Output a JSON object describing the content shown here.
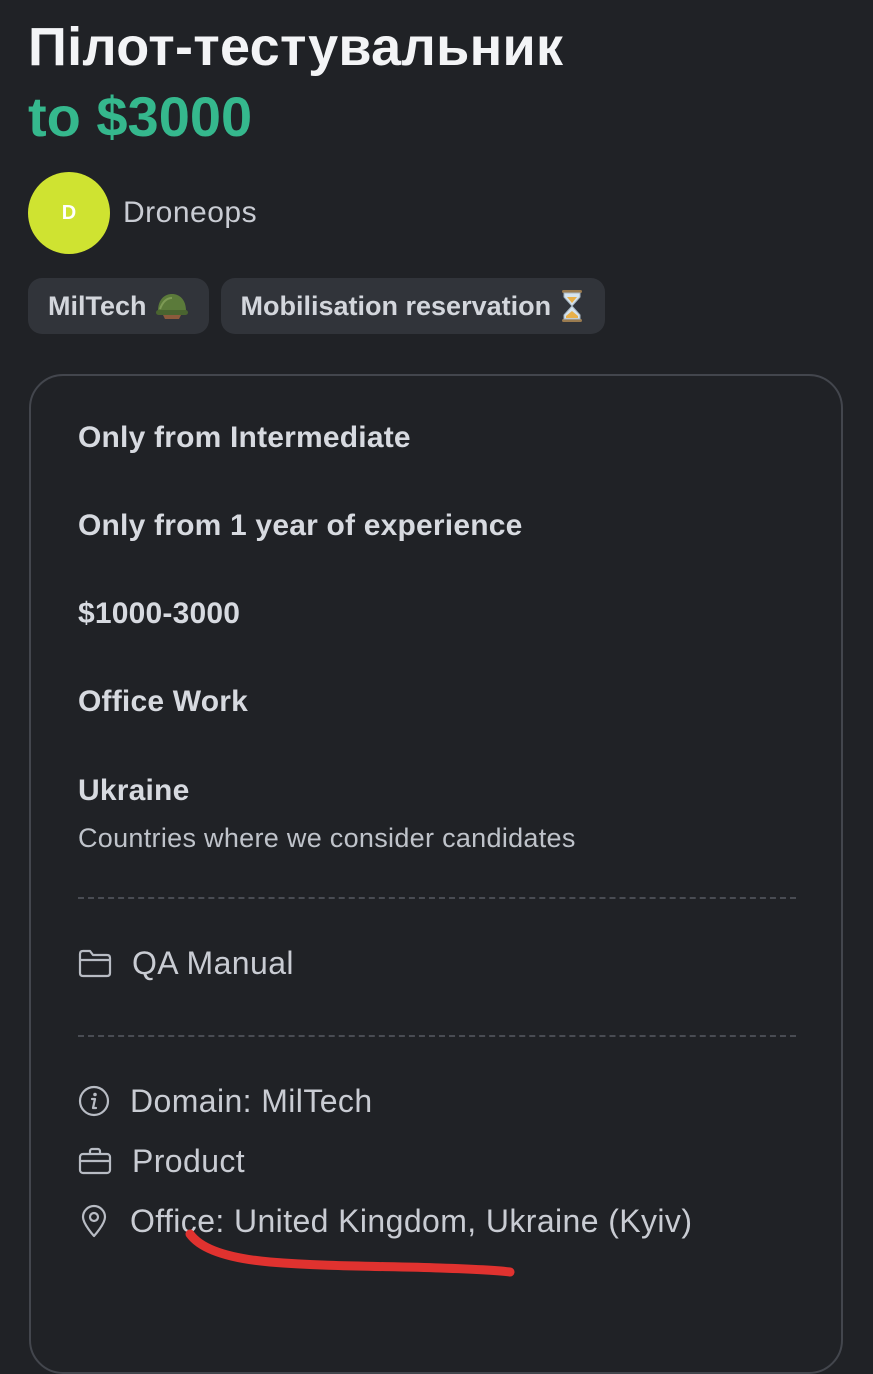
{
  "job": {
    "title": "Пілот-тестувальник",
    "salary": "to $3000"
  },
  "company": {
    "avatar_letter": "D",
    "name": "Droneops",
    "avatar_color": "#cfe331"
  },
  "tags": [
    {
      "label": "MilTech",
      "icon": "helmet-icon"
    },
    {
      "label": "Mobilisation reservation",
      "icon": "hourglass-icon"
    }
  ],
  "requirements": {
    "english": "Only from Intermediate",
    "experience": "Only from 1 year of experience",
    "salary_range": "$1000-3000",
    "work_format": "Office Work",
    "country": "Ukraine",
    "country_note": "Countries where we consider candidates"
  },
  "category": {
    "label": "QA Manual",
    "icon": "folder-icon"
  },
  "details": {
    "domain": "Domain: MilTech",
    "company_type": "Product",
    "office": "Office: United Kingdom, Ukraine (Kyiv)"
  },
  "colors": {
    "background": "#202226",
    "accent": "#35b88d",
    "annotation": "#e0322f"
  }
}
